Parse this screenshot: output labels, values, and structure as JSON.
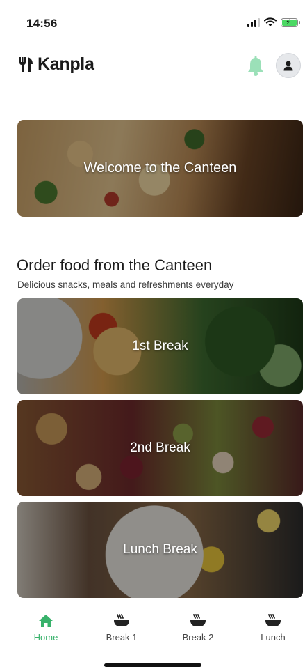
{
  "status_bar": {
    "time": "14:56",
    "icons": [
      "signal-icon",
      "wifi-icon",
      "battery-charging-icon"
    ]
  },
  "header": {
    "brand_name": "Kanpla",
    "brand_icon": "fork-knife-icon",
    "notification_icon": "bell-icon",
    "profile_icon": "user-icon"
  },
  "hero": {
    "label": "Welcome to the Canteen"
  },
  "section": {
    "title": "Order food from the Canteen",
    "subtitle": "Delicious snacks, meals and refreshments everyday"
  },
  "cards": [
    {
      "label": "1st Break"
    },
    {
      "label": "2nd Break"
    },
    {
      "label": "Lunch Break"
    }
  ],
  "bottom_nav": {
    "items": [
      {
        "label": "Home",
        "icon": "home-icon",
        "active": true
      },
      {
        "label": "Break 1",
        "icon": "bowl-icon",
        "active": false
      },
      {
        "label": "Break 2",
        "icon": "bowl-icon",
        "active": false
      },
      {
        "label": "Lunch",
        "icon": "bowl-icon",
        "active": false
      }
    ]
  },
  "colors": {
    "accent": "#38b26b",
    "bell": "#9be0b8",
    "text": "#1b1b1b"
  }
}
